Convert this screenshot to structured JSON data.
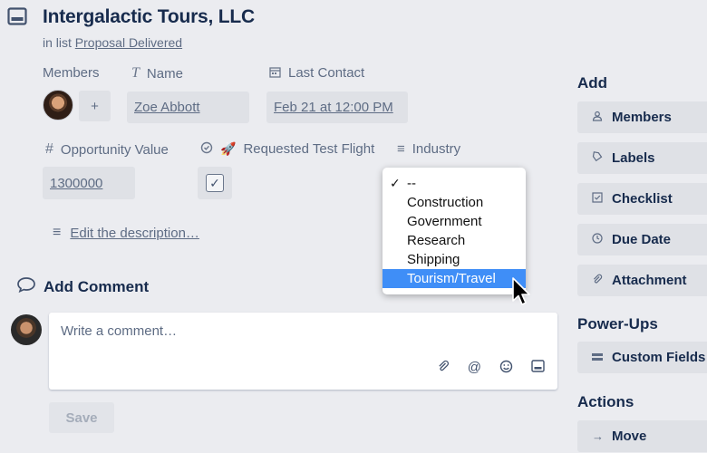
{
  "card": {
    "title": "Intergalactic Tours, LLC",
    "in_list_prefix": "in list",
    "list_name": "Proposal Delivered"
  },
  "fields": {
    "members_label": "Members",
    "add_member": "+",
    "name_label": "Name",
    "name_value": "Zoe Abbott",
    "last_contact_label": "Last Contact",
    "last_contact_value": "Feb 21 at 12:00 PM",
    "opportunity_label": "Opportunity Value",
    "opportunity_value": "1300000",
    "test_flight_label": "Requested Test Flight",
    "test_flight_checked": true,
    "industry_label": "Industry"
  },
  "industry_dropdown": {
    "options": [
      "--",
      "Construction",
      "Government",
      "Research",
      "Shipping",
      "Tourism/Travel"
    ],
    "checked": "--",
    "highlighted": "Tourism/Travel"
  },
  "description": {
    "link": "Edit the description…"
  },
  "comment": {
    "heading": "Add Comment",
    "placeholder": "Write a comment…",
    "save_label": "Save"
  },
  "sidebar": {
    "add_heading": "Add",
    "add_buttons": [
      {
        "icon": "user-icon",
        "label": "Members"
      },
      {
        "icon": "tag-icon",
        "label": "Labels"
      },
      {
        "icon": "checklist-icon",
        "label": "Checklist"
      },
      {
        "icon": "clock-icon",
        "label": "Due Date"
      },
      {
        "icon": "paperclip-icon",
        "label": "Attachment"
      }
    ],
    "powerups_heading": "Power-Ups",
    "powerups_buttons": [
      {
        "icon": "custom-fields-icon",
        "label": "Custom Fields"
      }
    ],
    "actions_heading": "Actions",
    "actions_buttons": [
      {
        "icon": "arrow-right-icon",
        "label": "Move"
      }
    ]
  },
  "colors": {
    "background": "#ebecf0",
    "highlight": "#3f8ef7",
    "text": "#172b4d"
  }
}
